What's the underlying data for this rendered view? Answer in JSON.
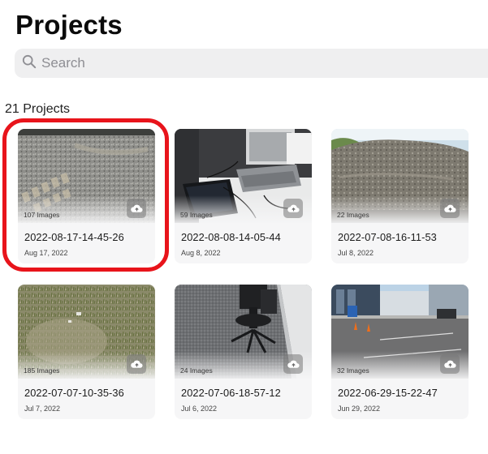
{
  "page": {
    "title": "Projects"
  },
  "search": {
    "placeholder": "Search"
  },
  "projects_count": "21 Projects",
  "colors": {
    "highlight": "#e8141b",
    "search_bg": "#efeff0",
    "card_bg": "#f6f6f7"
  },
  "projects": [
    {
      "name": "2022-08-17-14-45-26",
      "date": "Aug 17, 2022",
      "images": "107 Images",
      "thumb": "gravel-tracks",
      "highlighted": true
    },
    {
      "name": "2022-08-08-14-05-44",
      "date": "Aug 8, 2022",
      "images": "59 Images",
      "thumb": "laptop-desk",
      "highlighted": false
    },
    {
      "name": "2022-07-08-16-11-53",
      "date": "Jul 8, 2022",
      "images": "22 Images",
      "thumb": "dirt-mound",
      "highlighted": false
    },
    {
      "name": "2022-07-07-10-35-36",
      "date": "Jul 7, 2022",
      "images": "185 Images",
      "thumb": "grass-soil",
      "highlighted": false
    },
    {
      "name": "2022-07-06-18-57-12",
      "date": "Jul 6, 2022",
      "images": "24 Images",
      "thumb": "office-chair",
      "highlighted": false
    },
    {
      "name": "2022-06-29-15-22-47",
      "date": "Jun 29, 2022",
      "images": "32 Images",
      "thumb": "parking-lot",
      "highlighted": false
    }
  ]
}
